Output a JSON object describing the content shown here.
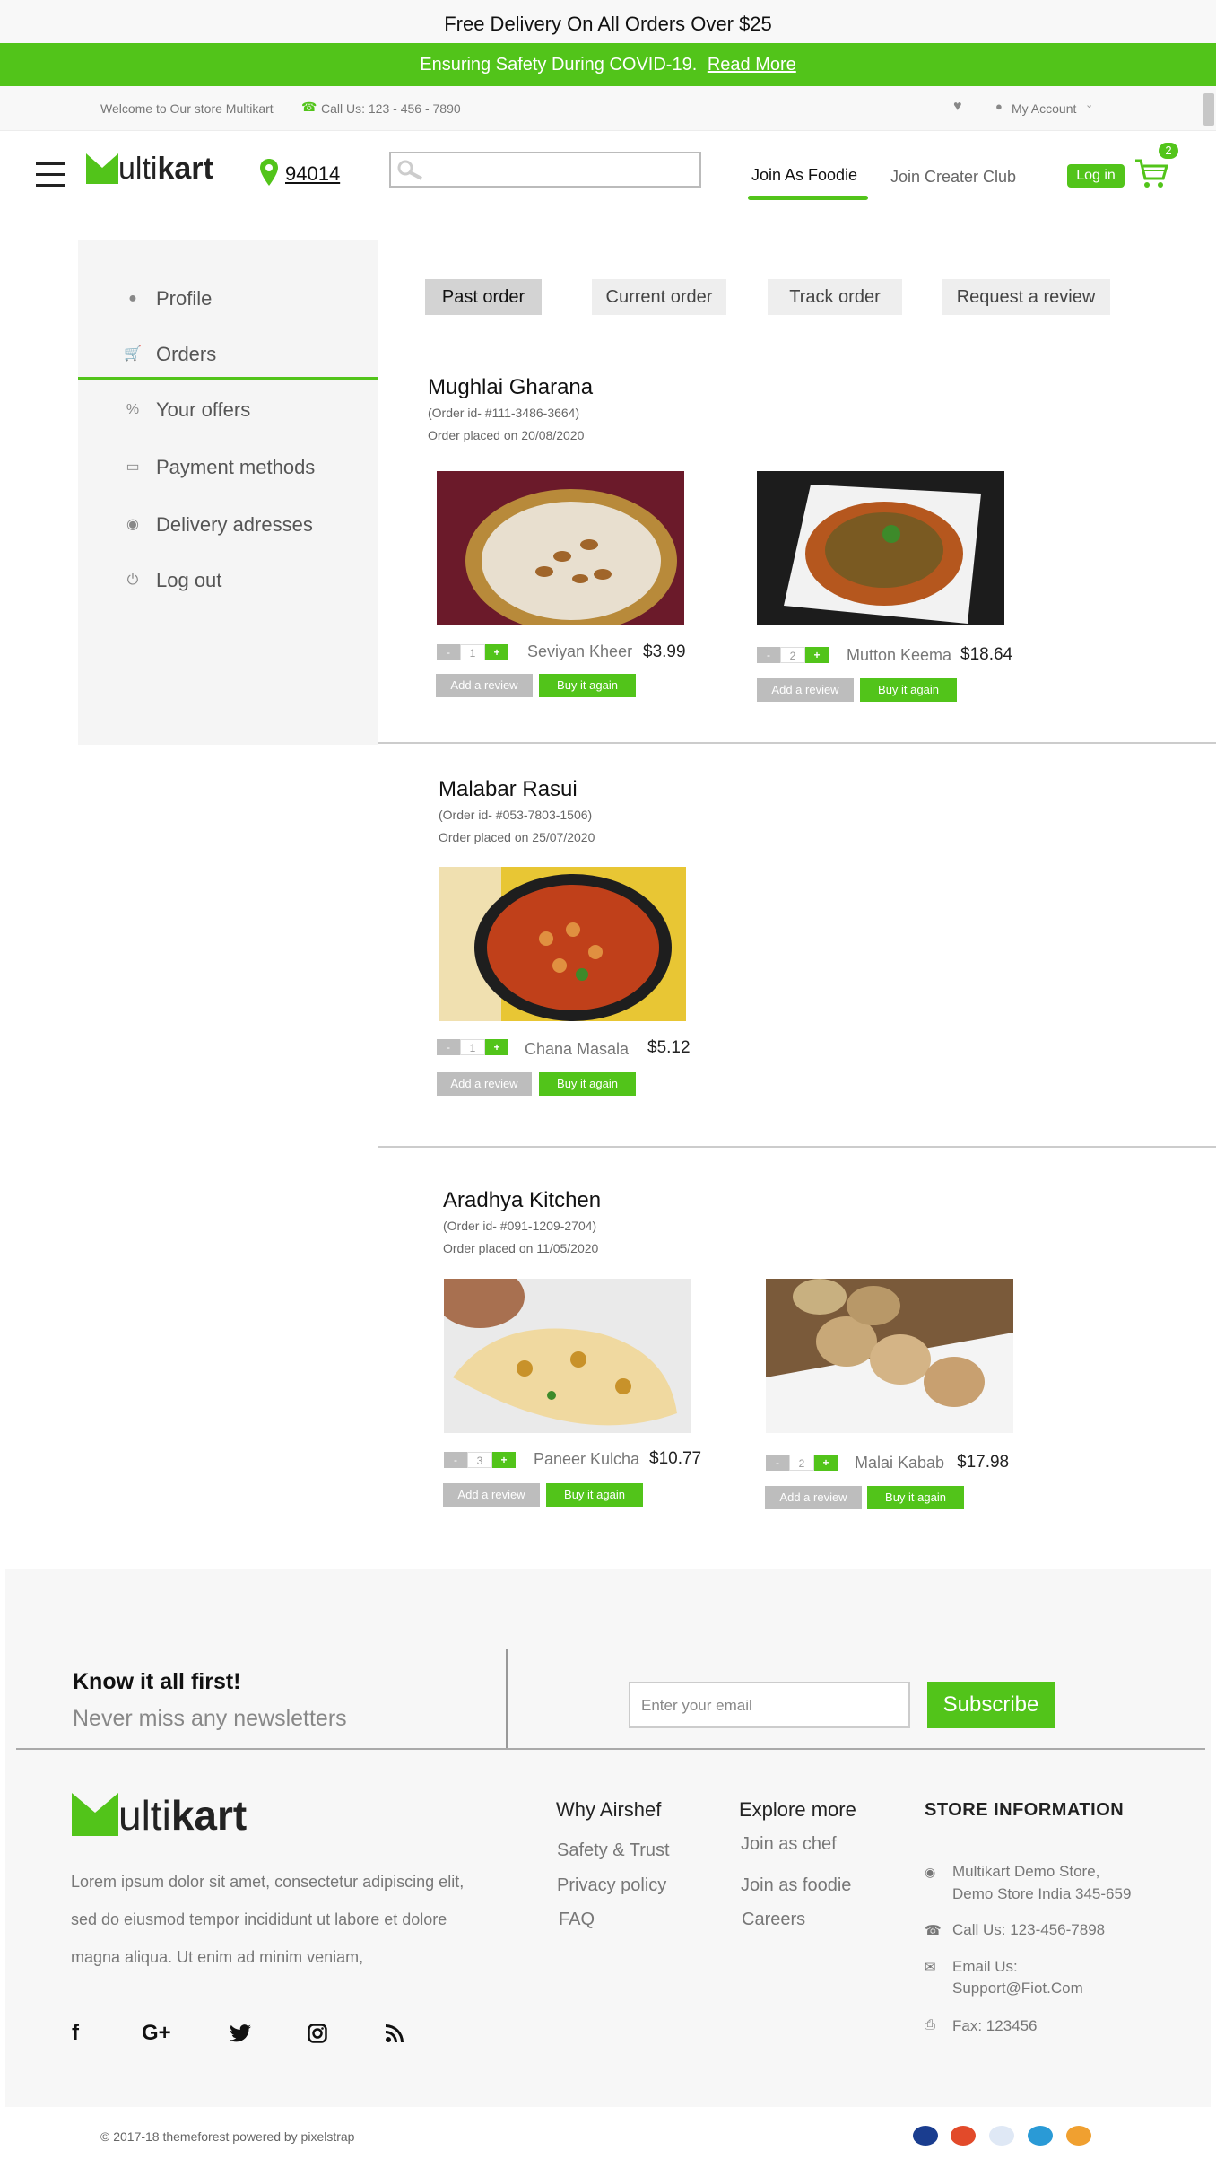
{
  "announcement": "Free Delivery On All Orders Over $25",
  "covid": {
    "text": "Ensuring Safety During COVID-19.",
    "link": "Read More"
  },
  "welcome": {
    "text": "Welcome to Our store Multikart",
    "call": "Call Us: 123 - 456 - 7890",
    "account": "My Account"
  },
  "header": {
    "logo_m": "M",
    "logo_ulti": "ulti",
    "logo_kart": "kart",
    "pincode": "94014",
    "search_placeholder": "",
    "nav": [
      "Join As Foodie",
      "Join Creater Club"
    ],
    "login": "Log in",
    "cart_count": "2"
  },
  "sidebar": {
    "items": [
      {
        "label": "Profile",
        "icon": "user-icon"
      },
      {
        "label": "Orders",
        "icon": "cart-icon"
      },
      {
        "label": "Your offers",
        "icon": "percent-icon"
      },
      {
        "label": "Payment methods",
        "icon": "payment-icon"
      },
      {
        "label": "Delivery adresses",
        "icon": "location-icon"
      },
      {
        "label": "Log out",
        "icon": "power-icon"
      }
    ]
  },
  "tabs": [
    "Past order",
    "Current order",
    "Track order",
    "Request a review"
  ],
  "orders": [
    {
      "restaurant": "Mughlai Gharana",
      "order_id": "(Order id- #111-3486-3664)",
      "placed": "Order placed on 20/08/2020",
      "items": [
        {
          "name": "Seviyan Kheer",
          "price": "$3.99",
          "qty": "1"
        },
        {
          "name": "Mutton Keema",
          "price": "$18.64",
          "qty": "2"
        }
      ]
    },
    {
      "restaurant": "Malabar Rasui",
      "order_id": "(Order id- #053-7803-1506)",
      "placed": "Order placed on 25/07/2020",
      "items": [
        {
          "name": "Chana Masala",
          "price": "$5.12",
          "qty": "1"
        }
      ]
    },
    {
      "restaurant": "Aradhya Kitchen",
      "order_id": "(Order id- #091-1209-2704)",
      "placed": "Order placed on 11/05/2020",
      "items": [
        {
          "name": "Paneer Kulcha",
          "price": "$10.77",
          "qty": "3"
        },
        {
          "name": "Malai Kabab",
          "price": "$17.98",
          "qty": "2"
        }
      ]
    }
  ],
  "buttons": {
    "review": "Add a review",
    "buy": "Buy it again",
    "minus": "-",
    "plus": "+"
  },
  "newsletter": {
    "title": "Know it all first!",
    "subtitle": "Never miss any newsletters",
    "placeholder": "Enter your email",
    "subscribe": "Subscribe"
  },
  "footer": {
    "about": "Lorem ipsum dolor sit amet, consectetur adipiscing elit, sed do eiusmod tempor incididunt ut labore et dolore magna aliqua. Ut enim ad minim veniam,",
    "why": {
      "title": "Why Airshef",
      "links": [
        "Safety & Trust",
        "Privacy policy",
        "FAQ"
      ]
    },
    "explore": {
      "title": "Explore more",
      "links": [
        "Join as chef",
        "Join as foodie",
        "Careers"
      ]
    },
    "store": {
      "title": "STORE INFORMATION",
      "address1": "Multikart Demo Store,",
      "address2": "Demo Store India 345-659",
      "call": "Call Us: 123-456-7898",
      "email1": "Email Us:",
      "email2": "Support@Fiot.Com",
      "fax": "Fax: 123456"
    },
    "social": [
      "facebook-icon",
      "google-plus-icon",
      "twitter-icon",
      "instagram-icon",
      "rss-icon"
    ],
    "copyright": "© 2017-18 themeforest powered by pixelstrap",
    "payments": [
      "visa-icon",
      "mastercard-icon",
      "paypal-icon",
      "amex-icon",
      "discover-icon"
    ]
  },
  "colors": {
    "accent": "#52c41a",
    "gray_btn": "#bdbdbd"
  }
}
